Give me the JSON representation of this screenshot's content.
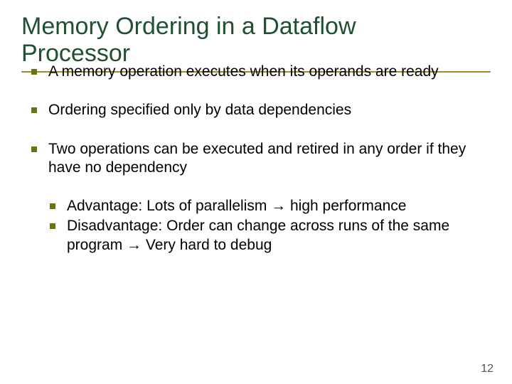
{
  "title_line1": "Memory Ordering in a Dataflow",
  "title_line2": "Processor",
  "bullets": {
    "b1": "A memory operation executes when its operands are ready",
    "b2": "Ordering specified only by data dependencies",
    "b3": "Two operations can be executed and retired in any order if they have no dependency",
    "b4": "Advantage: Lots of parallelism → high performance",
    "b5": "Disadvantage: Order can change across runs of the same program → Very hard to debug"
  },
  "page_number": "12"
}
